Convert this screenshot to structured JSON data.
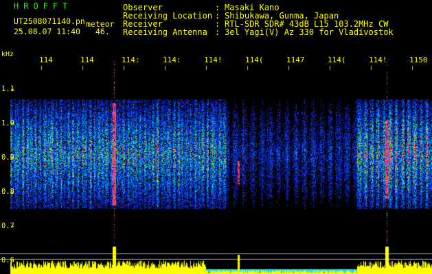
{
  "app_title": "HROFFT",
  "file": {
    "name": "UT2508071140.pn",
    "suffix": "meteor",
    "datetime": "25.08.07 11:40",
    "second": "46."
  },
  "info": [
    {
      "key": "Observer",
      "value": "Masaki Kano"
    },
    {
      "key": "Receiving Location",
      "value": "Shibukawa, Gunma, Japan"
    },
    {
      "key": "Receiver",
      "value": "RTL-SDR SDR# 43dB L15 103.2MHz CW"
    },
    {
      "key": "Receiving Antenna",
      "value": "3el Yagi(V) Az 330 for Vladivostok"
    }
  ],
  "info_separator": ":",
  "axis": {
    "unit": "kHz",
    "y_ticks": [
      "1.1",
      "1.0",
      "0.9",
      "0.8",
      "0.7",
      "0.6"
    ],
    "x_ticks": [
      "114",
      "114",
      "114:",
      "114:",
      "114!",
      "114(",
      "1147",
      "114(",
      "114!",
      "1150"
    ]
  },
  "colors": {
    "background": "#000000",
    "label": "#ffff00",
    "title": "#2ee82e",
    "level_trace": "#ffff00",
    "level_baseline": "#00e5ff",
    "tick_line": "#b0c4de",
    "meteor": "#ff3399"
  }
}
